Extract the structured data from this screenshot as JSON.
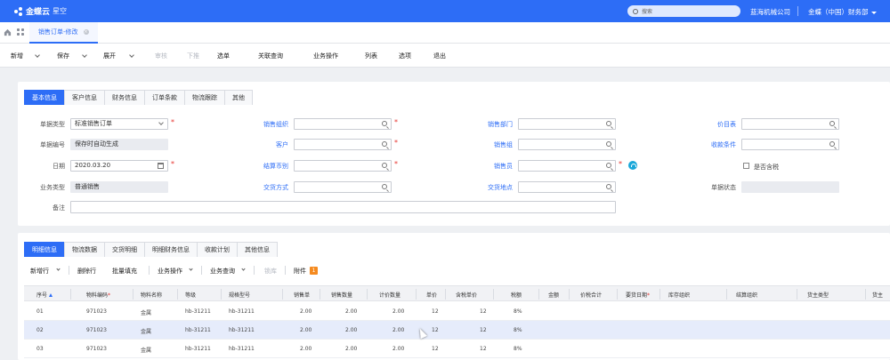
{
  "app": {
    "brand": "金蝶云",
    "sub": "星空"
  },
  "topbar": {
    "search_placeholder": "搜索",
    "org": "蓝海机械公司",
    "user_org": "金蝶（中国）财务部"
  },
  "tabstrip": {
    "doc_tab": "销售订单-修改"
  },
  "toolbar": {
    "new": "新增",
    "save": "保存",
    "expand": "展开",
    "audit": "审核",
    "push": "下推",
    "select_bill": "选单",
    "related_query": "关联查询",
    "biz_ops": "业务操作",
    "list": "列表",
    "options": "选项",
    "exit": "退出"
  },
  "header_tabs": [
    "基本信息",
    "客户信息",
    "财务信息",
    "订单条款",
    "物流跟踪",
    "其他"
  ],
  "form": {
    "bill_type_label": "单据类型",
    "bill_type_value": "标准销售订单",
    "bill_no_label": "单据编号",
    "bill_no_value": "保存时自动生成",
    "date_label": "日期",
    "date_value": "2020.03.20",
    "biz_type_label": "业务类型",
    "biz_type_value": "普通销售",
    "remark_label": "备注",
    "sale_org_label": "销售组织",
    "customer_label": "客户",
    "currency_label": "结算币别",
    "delivery_method_label": "交货方式",
    "sale_dept_label": "销售部门",
    "sale_group_label": "销售组",
    "salesman_label": "销售员",
    "delivery_place_label": "交货地点",
    "price_list_label": "价目表",
    "payment_terms_label": "收款条件",
    "tax_included_label": "是否含税",
    "bill_status_label": "单据状态"
  },
  "detail_tabs": [
    "明细信息",
    "物流数据",
    "交货明细",
    "明细财务信息",
    "收款计划",
    "其他信息"
  ],
  "detail_toolbar": {
    "add_row": "新增行",
    "delete_row": "删除行",
    "batch_fill": "批量填充",
    "biz_ops": "业务操作",
    "biz_query": "业务查询",
    "lock": "锁库",
    "attachment": "附件",
    "attachment_count": "1"
  },
  "table": {
    "headers": [
      "序号",
      "物料编码",
      "物料名称",
      "等级",
      "规格型号",
      "销售单",
      "销售数量",
      "计价数量",
      "单价",
      "含税单价",
      "税额",
      "金额",
      "价税合计",
      "要货日期",
      "库存组织",
      "结算组织",
      "货主类型",
      "货主"
    ],
    "rows": [
      [
        "01",
        "971023",
        "金属",
        "hb-31211",
        "hb-31211",
        "2.00",
        "2.00",
        "2.00",
        "12",
        "12",
        "8%"
      ],
      [
        "02",
        "971023",
        "金属",
        "hb-31211",
        "hb-31211",
        "2.00",
        "2.00",
        "2.00",
        "12",
        "12",
        "8%"
      ],
      [
        "03",
        "971023",
        "金属",
        "hb-31211",
        "hb-31211",
        "2.00",
        "2.00",
        "2.00",
        "12",
        "12",
        "8%"
      ]
    ]
  },
  "colors": {
    "primary": "#2d6df6",
    "required": "#e6322d",
    "badge": "#f58a1f"
  }
}
